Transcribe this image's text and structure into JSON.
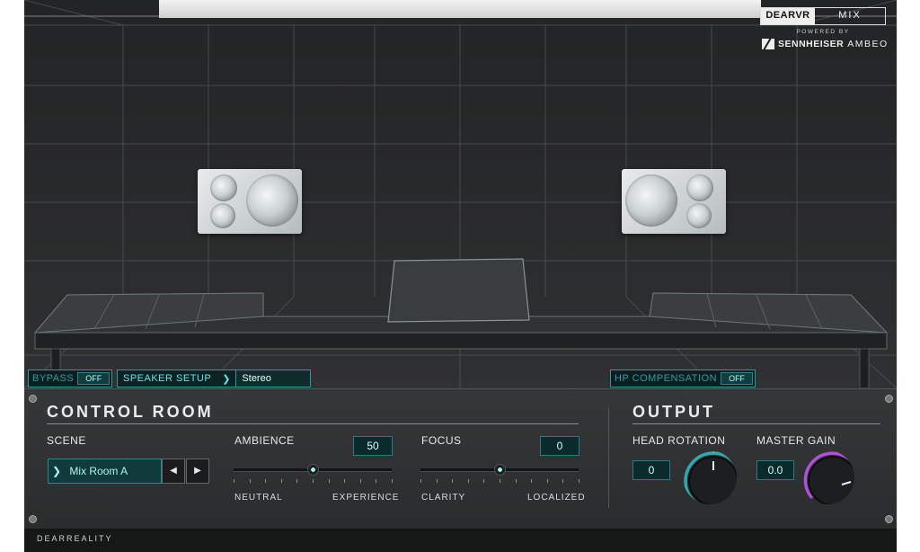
{
  "brand": {
    "dear": "DEARVR",
    "product": "MIX",
    "powered_by": "POWERED BY",
    "sennheiser": "SENNHEISER",
    "ambeo": "AMBEO"
  },
  "room_controls": {
    "bypass_label": "BYPASS",
    "bypass_value": "OFF",
    "speaker_setup_label": "SPEAKER SETUP",
    "speaker_setup_value": "Stereo",
    "hp_comp_label": "HP COMPENSATION",
    "hp_comp_value": "OFF"
  },
  "control_room": {
    "title": "CONTROL ROOM",
    "scene_label": "SCENE",
    "scene_value": "Mix Room A",
    "ambience_label": "AMBIENCE",
    "ambience_value": "50",
    "ambience_level": 0.5,
    "ambience_min": "NEUTRAL",
    "ambience_max": "EXPERIENCE",
    "focus_label": "FOCUS",
    "focus_value": "0",
    "focus_level": 0.5,
    "focus_min": "CLARITY",
    "focus_max": "LOCALIZED"
  },
  "output": {
    "title": "OUTPUT",
    "head_rotation_label": "HEAD ROTATION",
    "head_rotation_value": "0",
    "master_gain_label": "MASTER GAIN",
    "master_gain_value": "0.0"
  },
  "footer": {
    "brand": "DEARREALITY"
  },
  "colors": {
    "accent": "#2fb8bb",
    "gain_accent": "#b14fd6"
  }
}
